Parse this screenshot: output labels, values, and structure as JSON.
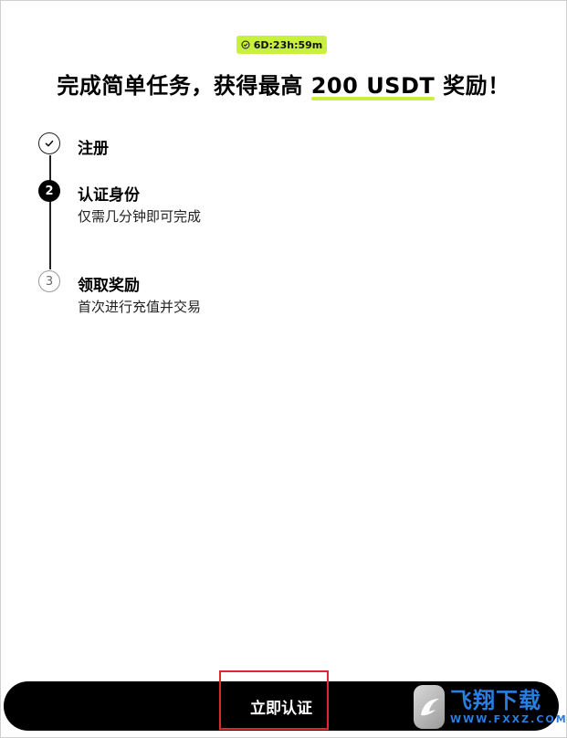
{
  "timer": {
    "text": "6D:23h:59m",
    "icon": "clock-check-icon"
  },
  "headline": {
    "prefix": "完成简单任务，获得最高 ",
    "amount": "200 USDT",
    "suffix": " 奖励！"
  },
  "steps": [
    {
      "marker": "✓",
      "title": "注册",
      "subtitle": "",
      "state": "completed"
    },
    {
      "marker": "2",
      "title": "认证身份",
      "subtitle": "仅需几分钟即可完成",
      "state": "current"
    },
    {
      "marker": "3",
      "title": "领取奖励",
      "subtitle": "首次进行充值并交易",
      "state": "upcoming"
    }
  ],
  "cta": {
    "label": "立即认证"
  },
  "watermark": {
    "text": "飞翔下载",
    "domain": "WWW.FXXZ.COM"
  },
  "colors": {
    "accent": "#c8f03c",
    "primary": "#000000",
    "highlight": "#e0282e",
    "watermark": "#2a7de1"
  }
}
